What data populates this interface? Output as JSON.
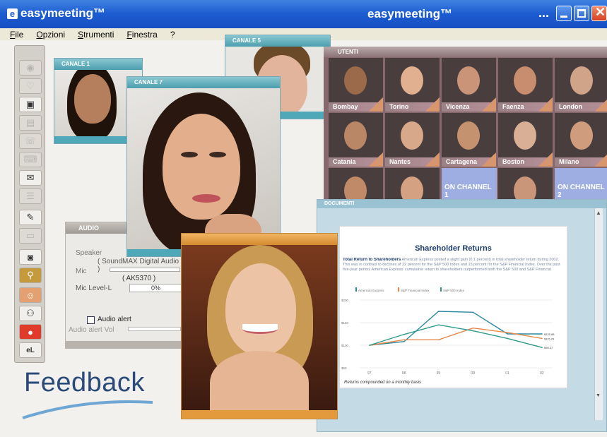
{
  "app": {
    "title": "easymeeting™",
    "caption": "easymeeting™",
    "overflow": "..."
  },
  "menu": [
    "File",
    "Opzioni",
    "Strumenti",
    "Finestra",
    "?"
  ],
  "toolbar_icons": [
    "eye-icon",
    "heart-icon",
    "monitor-icon",
    "document-icon",
    "chat-icon",
    "keyboard-icon",
    "mail-icon",
    "notes-icon",
    "pencil-icon",
    "screen-icon",
    "camera-icon",
    "magnifier-icon",
    "smiley-icon",
    "users-icon",
    "record-icon",
    "el-icon"
  ],
  "windows": {
    "canale1": {
      "title": "CANALE 1"
    },
    "canale7": {
      "title": "CANALE 7"
    },
    "canale5": {
      "title": "CANALE 5"
    },
    "audio": {
      "title": "AUDIO",
      "speaker_label": "Speaker",
      "speaker_device": "( SoundMAX Digital Audio )",
      "mic_label": "Mic",
      "mic_device": "( AK5370 )",
      "mic_level_label": "Mic Level-L",
      "mic_level_value": "0%",
      "audio_alert_label": "Audio alert",
      "audio_alert_vol_label": "Audio alert Vol"
    },
    "utenti": {
      "title": "UTENTI",
      "users": [
        {
          "city": "Bombay"
        },
        {
          "city": "Torino"
        },
        {
          "city": "Vicenza"
        },
        {
          "city": "Faenza"
        },
        {
          "city": "London"
        },
        {
          "city": "Catania"
        },
        {
          "city": "Nantes"
        },
        {
          "city": "Cartagena"
        },
        {
          "city": "Boston"
        },
        {
          "city": "Milano"
        }
      ],
      "on_channel_1": "ON CHANNEL 1",
      "on_channel_2": "ON CHANNEL 2"
    },
    "documenti": {
      "title": "DOCUMENTI"
    }
  },
  "document": {
    "heading": "Shareholder Returns",
    "para_bold": "Total Return to Shareholders",
    "para_text": "American Express posted a slight gain (0.1 percent) in total shareholder return during 2002. This was in contrast to declines of 22 percent for the S&P 500 Index and 15 percent for the S&P Financial Index. Over the past five-year period, American Express' cumulative return to shareholders outperformed both the S&P 500 and S&P Financial",
    "footnote": "Returns compounded on a monthly basis"
  },
  "chart_data": {
    "type": "line",
    "categories": [
      "97",
      "98",
      "99",
      "00",
      "01",
      "02"
    ],
    "series": [
      {
        "name": "American Express",
        "values": [
          100,
          108,
          175,
          173,
          125,
          125
        ],
        "end_label": "$125.88"
      },
      {
        "name": "S&P Financial Index",
        "values": [
          100,
          112,
          112,
          138,
          128,
          115
        ],
        "end_label": "$115.29"
      },
      {
        "name": "S&P 500 Index",
        "values": [
          100,
          124,
          145,
          132,
          115,
          95
        ],
        "end_label": "$95.37"
      }
    ],
    "colors": [
      "#2a8a9e",
      "#e8874a",
      "#2e9a8a"
    ],
    "ytick_labels": [
      "$50",
      "$100",
      "$150",
      "$200"
    ],
    "ylim": [
      50,
      200
    ]
  },
  "brand": {
    "feedback": "Feedback"
  }
}
